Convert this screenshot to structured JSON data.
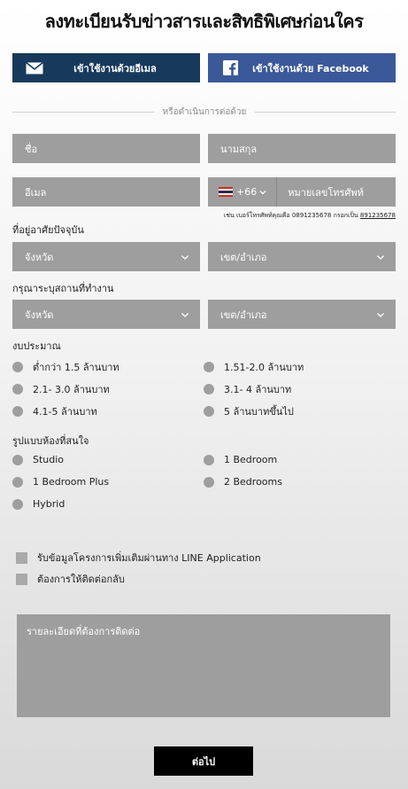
{
  "title": "ลงทะเบียนรับข่าวสารและสิทธิพิเศษก่อนใคร",
  "social": {
    "email_label": "เข้าใช้งานด้วยอีเมล",
    "facebook_label": "เข้าใช้งานด้วย Facebook"
  },
  "or_text": "หรือดำเนินการต่อด้วย",
  "fields": {
    "first_name": "ชื่อ",
    "last_name": "นามสกุล",
    "email": "อีเมล",
    "phone_code": "+66",
    "phone": "หมายเลขโทรศัพท์"
  },
  "phone_hint": {
    "text": "เช่น เบอร์โทรศัพท์คุณคือ 0891235678 กรอกเป็น ",
    "example": "891235678"
  },
  "residence": {
    "label": "ที่อยู่อาศัยปัจจุบัน",
    "province": "จังหวัด",
    "district": "เขต/อำเภอ"
  },
  "workplace": {
    "label": "กรุณาระบุสถานที่ทำงาน",
    "province": "จังหวัด",
    "district": "เขต/อำเภอ"
  },
  "budget": {
    "label": "งบประมาณ",
    "options": [
      "ต่ำกว่า 1.5 ล้านบาท",
      "1.51-2.0 ล้านบาท",
      "2.1- 3.0 ล้านบาท",
      "3.1- 4 ล้านบาท",
      "4.1-5 ล้านบาท",
      "5 ล้านบาทขึ้นไป"
    ]
  },
  "room_type": {
    "label": "รูปแบบห้องที่สนใจ",
    "options": [
      "Studio",
      "1 Bedroom",
      "1 Bedroom Plus",
      "2 Bedrooms",
      "Hybrid"
    ]
  },
  "checks": [
    "รับข้อมูลโครงการเพิ่มเติมผ่านทาง LINE Application",
    "ต้องการให้ติดต่อกลับ"
  ],
  "details_placeholder": "รายละเอียดที่ต้องการติดต่อ",
  "submit_label": "ต่อไป",
  "colors": {
    "email_button": "#173a5c",
    "facebook_button": "#3b5998",
    "field_bg": "#9e9e9e",
    "submit_bg": "#000000"
  }
}
